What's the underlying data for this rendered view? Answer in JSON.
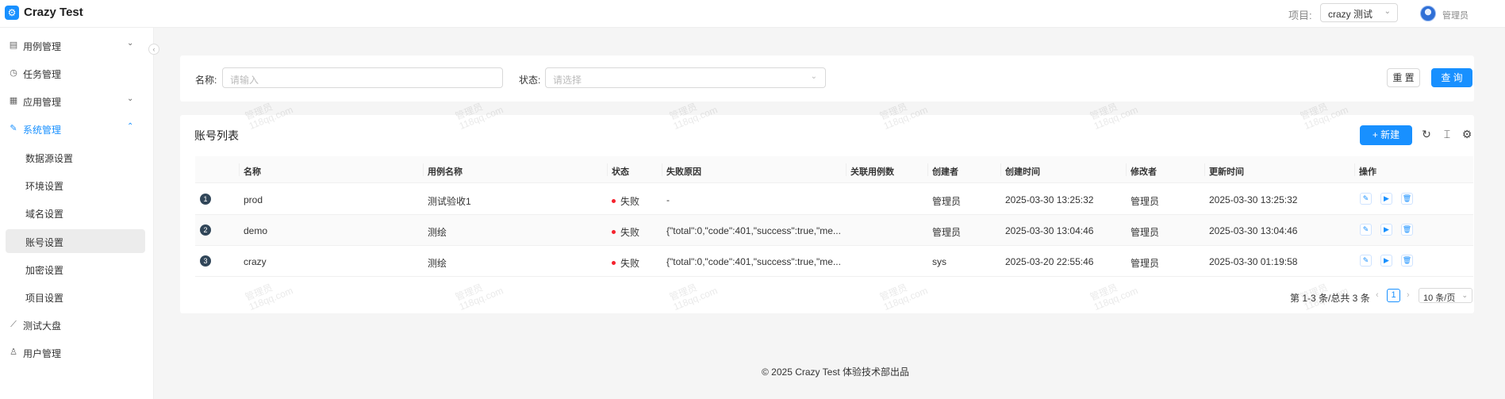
{
  "header": {
    "app_title": "Crazy Test",
    "project_label": "项目:",
    "project_value": "crazy 测试",
    "user_name": "管理员"
  },
  "sidebar": {
    "items": [
      {
        "label": "用例管理",
        "icon": "file-icon",
        "expandable": true
      },
      {
        "label": "任务管理",
        "icon": "clock-icon",
        "expandable": false
      },
      {
        "label": "应用管理",
        "icon": "grid-icon",
        "expandable": true
      },
      {
        "label": "系统管理",
        "icon": "wrench-icon",
        "expandable": true,
        "active": true
      },
      {
        "label": "测试大盘",
        "icon": "chart-icon",
        "expandable": false
      },
      {
        "label": "用户管理",
        "icon": "user-icon",
        "expandable": false
      }
    ],
    "sub_items": [
      {
        "label": "数据源设置"
      },
      {
        "label": "环境设置"
      },
      {
        "label": "域名设置"
      },
      {
        "label": "账号设置",
        "selected": true
      },
      {
        "label": "加密设置"
      },
      {
        "label": "项目设置"
      }
    ]
  },
  "search": {
    "name_label": "名称:",
    "name_placeholder": "请输入",
    "status_label": "状态:",
    "status_placeholder": "请选择",
    "reset_label": "重 置",
    "query_label": "查 询"
  },
  "table": {
    "title": "账号列表",
    "new_label": "新建",
    "columns": [
      "名称",
      "用例名称",
      "状态",
      "失败原因",
      "关联用例数",
      "创建者",
      "创建时间",
      "修改者",
      "更新时间",
      "操作"
    ],
    "rows": [
      {
        "index": "1",
        "name": "prod",
        "case_name": "测试验收1",
        "status": "失败",
        "reason": "-",
        "linked": "",
        "creator": "管理员",
        "created": "2025-03-30 13:25:32",
        "modifier": "管理员",
        "updated": "2025-03-30 13:25:32"
      },
      {
        "index": "2",
        "name": "demo",
        "case_name": "测绘",
        "status": "失败",
        "reason": "{\"total\":0,\"code\":401,\"success\":true,\"me...",
        "linked": "",
        "creator": "管理员",
        "created": "2025-03-30 13:04:46",
        "modifier": "管理员",
        "updated": "2025-03-30 13:04:46"
      },
      {
        "index": "3",
        "name": "crazy",
        "case_name": "测绘",
        "status": "失败",
        "reason": "{\"total\":0,\"code\":401,\"success\":true,\"me...",
        "linked": "",
        "creator": "sys",
        "created": "2025-03-20 22:55:46",
        "modifier": "管理员",
        "updated": "2025-03-30 01:19:58"
      }
    ]
  },
  "pagination": {
    "summary": "第 1-3 条/总共 3 条",
    "current": "1",
    "page_size": "10 条/页"
  },
  "footer": "© 2025 Crazy Test 体验技术部出品",
  "watermark": {
    "line1": "管理员",
    "line2": "118qq.com"
  },
  "colors": {
    "accent": "#1890ff",
    "error": "#f5222d"
  }
}
